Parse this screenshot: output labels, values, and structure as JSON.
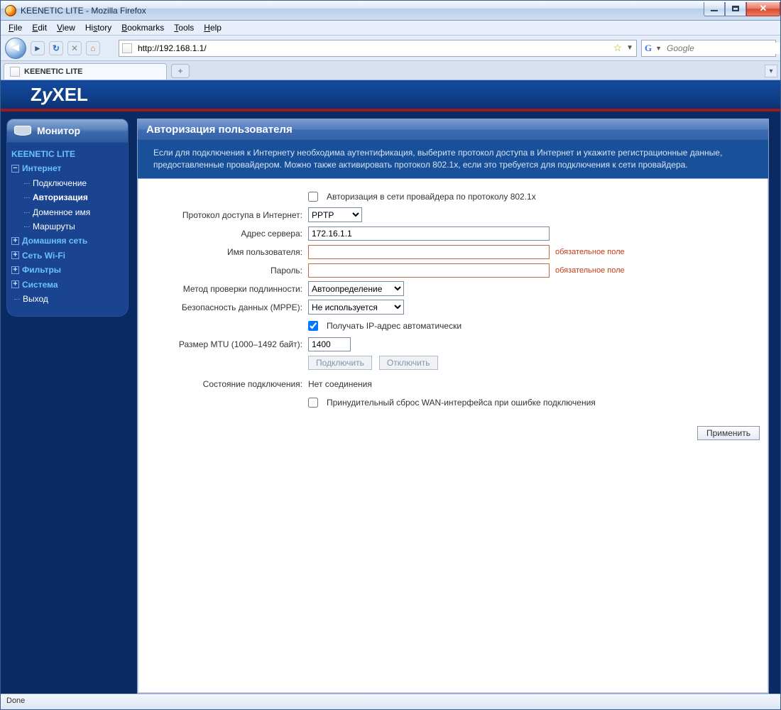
{
  "window": {
    "title": "KEENETIC LITE - Mozilla Firefox"
  },
  "menu": {
    "file": "File",
    "edit": "Edit",
    "view": "View",
    "history": "History",
    "bookmarks": "Bookmarks",
    "tools": "Tools",
    "help": "Help"
  },
  "url": "http://192.168.1.1/",
  "search": {
    "engine": "Google",
    "placeholder": "Google"
  },
  "tab": {
    "title": "KEENETIC LITE"
  },
  "logo": "ZyXEL",
  "sidebar": {
    "monitor": "Монитор",
    "root": "KEENETIC LITE",
    "internet": "Интернет",
    "internet_items": [
      "Подключение",
      "Авторизация",
      "Доменное имя",
      "Маршруты"
    ],
    "home_net": "Домашняя сеть",
    "wifi": "Сеть Wi-Fi",
    "filters": "Фильтры",
    "system": "Система",
    "logout": "Выход"
  },
  "panel": {
    "title": "Авторизация пользователя",
    "info": "Если для подключения к Интернету необходима аутентификация, выберите протокол доступа в Интернет и укажите регистрационные данные, предоставленные провайдером. Можно также активировать протокол 802.1x, если это требуется для подключения к сети провайдера.",
    "auth8021x_label": "Авторизация в сети провайдера по протоколу 802.1x",
    "protocol_label": "Протокол доступа в Интернет:",
    "protocol_value": "PPTP",
    "server_label": "Адрес сервера:",
    "server_value": "172.16.1.1",
    "user_label": "Имя пользователя:",
    "user_value": "",
    "pass_label": "Пароль:",
    "pass_value": "",
    "required": "обязательное поле",
    "auth_method_label": "Метод проверки подлинности:",
    "auth_method_value": "Автоопределение",
    "mppe_label": "Безопасность данных (MPPE):",
    "mppe_value": "Не используется",
    "auto_ip_label": "Получать IP-адрес автоматически",
    "mtu_label": "Размер MTU (1000–1492 байт):",
    "mtu_value": "1400",
    "connect_btn": "Подключить",
    "disconnect_btn": "Отключить",
    "conn_state_label": "Состояние подключения:",
    "conn_state_value": "Нет соединения",
    "force_reset_label": "Принудительный сброс WAN-интерфейса при ошибке подключения",
    "apply_btn": "Применить"
  },
  "status": "Done"
}
